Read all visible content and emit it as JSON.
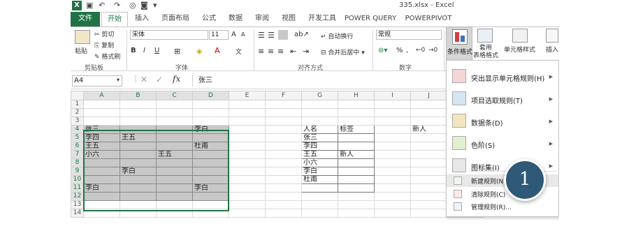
{
  "title": "335.xlsx - Excel",
  "tabs": [
    "文件",
    "开始",
    "插入",
    "页面布局",
    "公式",
    "数据",
    "审阅",
    "视图",
    "开发工具",
    "POWER QUERY",
    "POWERPIVOT"
  ],
  "clipboard": {
    "paste": "粘贴",
    "cut": "剪切",
    "copy": "复制",
    "format_painter": "格式刷",
    "label": "剪贴板"
  },
  "font": {
    "name": "宋体",
    "size": "11",
    "label": "字体",
    "bold": "B",
    "italic": "I",
    "underline": "U",
    "grow": "A",
    "shrink": "A"
  },
  "align": {
    "wrap": "自动换行",
    "merge": "合并后居中",
    "label": "对齐方式"
  },
  "number": {
    "format": "常规",
    "label": "数字",
    "percent": "%"
  },
  "styles": {
    "cond_format": "条件格式",
    "table_format": "套用\n表格格式",
    "cell_styles": "单元格样式",
    "insert": "插入"
  },
  "formula_bar": {
    "name_box": "A4",
    "fx": "fx",
    "value": "张三"
  },
  "columns": [
    "A",
    "B",
    "C",
    "D",
    "E",
    "F",
    "G",
    "H",
    "I",
    "J"
  ],
  "rows": [
    [
      "",
      "",
      "",
      "",
      "",
      "",
      "",
      "",
      "",
      ""
    ],
    [
      "",
      "",
      "",
      "",
      "",
      "",
      "",
      "",
      "",
      ""
    ],
    [
      "",
      "",
      "",
      "",
      "",
      "",
      "",
      "",
      "",
      ""
    ],
    [
      "张三",
      "",
      "",
      "李白",
      "",
      "",
      "人名",
      "标签",
      "",
      "新人"
    ],
    [
      "李四",
      "王五",
      "",
      "",
      "",
      "",
      "张三",
      "",
      "",
      ""
    ],
    [
      "王五",
      "",
      "",
      "杜甫",
      "",
      "",
      "李四",
      "",
      "",
      ""
    ],
    [
      "小六",
      "",
      "王五",
      "",
      "",
      "",
      "王五",
      "新人",
      "",
      ""
    ],
    [
      "",
      "",
      "",
      "",
      "",
      "",
      "小六",
      "",
      "",
      ""
    ],
    [
      "",
      "李白",
      "",
      "",
      "",
      "",
      "李白",
      "",
      "",
      ""
    ],
    [
      "",
      "",
      "",
      "",
      "",
      "",
      "杜甫",
      "",
      "",
      ""
    ],
    [
      "李白",
      "",
      "",
      "李白",
      "",
      "",
      "",
      "",
      "",
      ""
    ],
    [
      "",
      "",
      "",
      "",
      "",
      "",
      "",
      "",
      "",
      ""
    ],
    [
      "",
      "",
      "",
      "",
      "",
      "",
      "",
      "",
      "",
      ""
    ],
    [
      "",
      "",
      "",
      "",
      "",
      "",
      "",
      "",
      "",
      ""
    ]
  ],
  "menu": [
    {
      "label": "突出显示单元格规则(H)",
      "sub": true
    },
    {
      "label": "项目选取规则(T)",
      "sub": true
    },
    {
      "label": "数据条(D)",
      "sub": true
    },
    {
      "label": "色阶(S)",
      "sub": true
    },
    {
      "label": "图标集(I)",
      "sub": true
    },
    {
      "label": "新建规则(N)...",
      "sub": false
    },
    {
      "label": "清除规则(C)",
      "sub": true
    },
    {
      "label": "管理规则(R)...",
      "sub": false
    }
  ],
  "step": "1",
  "colors": {
    "excel_green": "#217346",
    "selection": "#c8c8c8",
    "badge": "#2e5a78"
  }
}
